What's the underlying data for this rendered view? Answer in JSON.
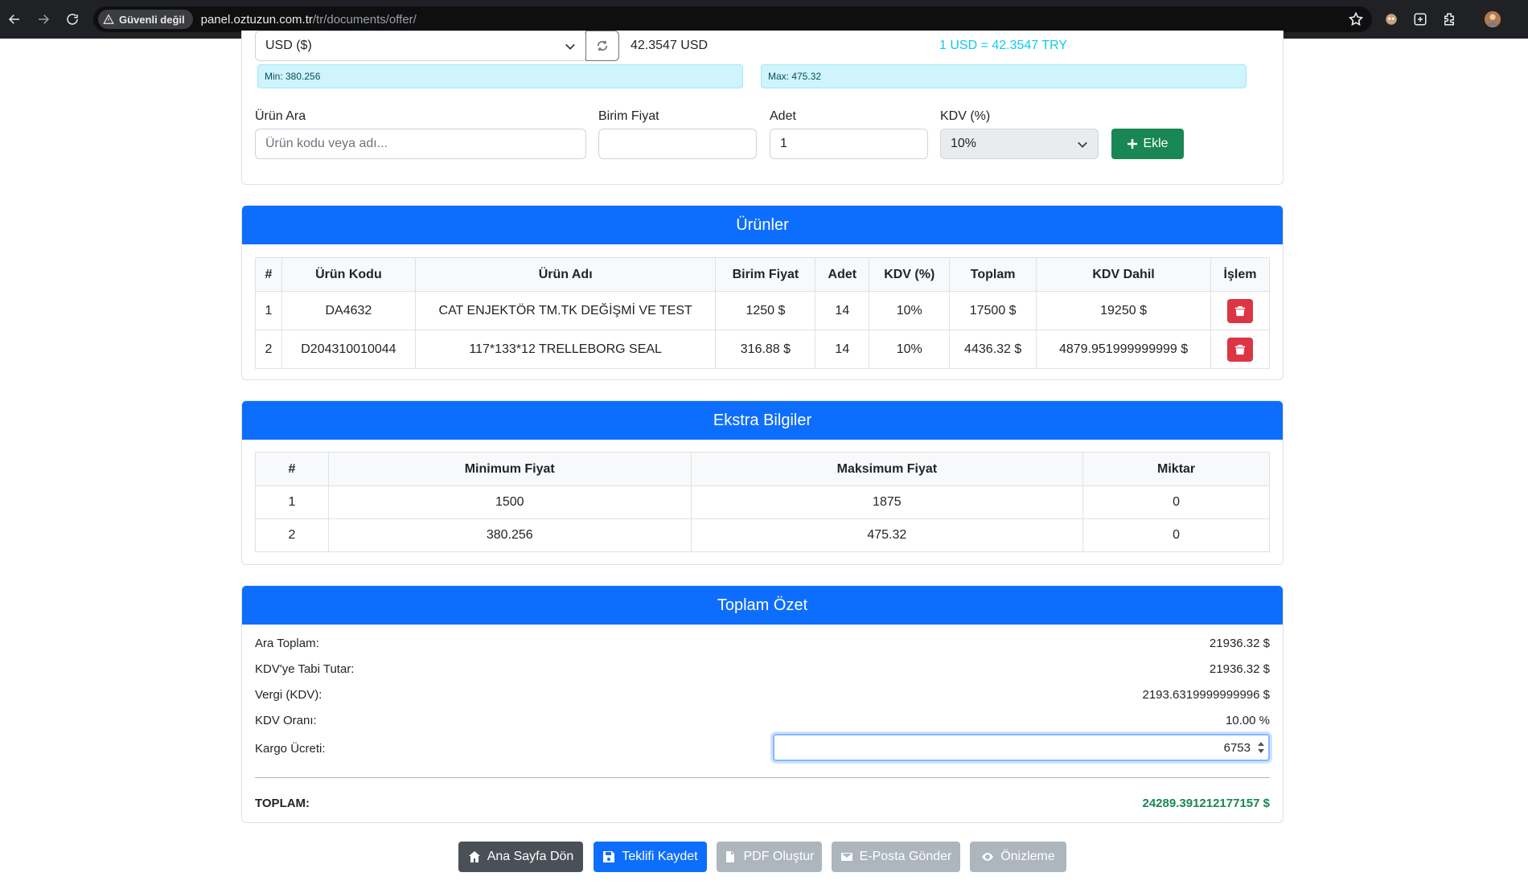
{
  "browser": {
    "security_label": "Güvenli değil",
    "url_host": "panel.oztuzun.com.tr",
    "url_path": "/tr/documents/offer/"
  },
  "currency": {
    "selected": "USD ($)",
    "rate_value": "42.3547 USD",
    "rate_info": "1 USD = 42.3547 TRY",
    "min_info": "Min: 380.256",
    "max_info": "Max: 475.32"
  },
  "product_form": {
    "search_label": "Ürün Ara",
    "search_placeholder": "Ürün kodu veya adı...",
    "unit_price_label": "Birim Fiyat",
    "unit_price_value": "",
    "qty_label": "Adet",
    "qty_value": "1",
    "vat_label": "KDV (%)",
    "vat_selected": "10%",
    "add_label": "Ekle"
  },
  "products": {
    "title": "Ürünler",
    "columns": [
      "#",
      "Ürün Kodu",
      "Ürün Adı",
      "Birim Fiyat",
      "Adet",
      "KDV (%)",
      "Toplam",
      "KDV Dahil",
      "İşlem"
    ],
    "rows": [
      {
        "no": "1",
        "code": "DA4632",
        "name": "CAT ENJEKTÖR TM.TK DEĞİŞMİ VE TEST",
        "unit_price": "1250 $",
        "qty": "14",
        "vat": "10%",
        "total": "17500 $",
        "total_vat": "19250 $"
      },
      {
        "no": "2",
        "code": "D204310010044",
        "name": "117*133*12 TRELLEBORG SEAL",
        "unit_price": "316.88 $",
        "qty": "14",
        "vat": "10%",
        "total": "4436.32 $",
        "total_vat": "4879.951999999999 $"
      }
    ]
  },
  "extra": {
    "title": "Ekstra Bilgiler",
    "columns": [
      "#",
      "Minimum Fiyat",
      "Maksimum Fiyat",
      "Miktar"
    ],
    "rows": [
      {
        "no": "1",
        "min": "1500",
        "max": "1875",
        "qty": "0"
      },
      {
        "no": "2",
        "min": "380.256",
        "max": "475.32",
        "qty": "0"
      }
    ]
  },
  "summary": {
    "title": "Toplam Özet",
    "subtotal_label": "Ara Toplam:",
    "subtotal_value": "21936.32 $",
    "taxable_label": "KDV'ye Tabi Tutar:",
    "taxable_value": "21936.32 $",
    "tax_label": "Vergi (KDV):",
    "tax_value": "2193.6319999999996 $",
    "rate_label": "KDV Oranı:",
    "rate_value": "10.00 %",
    "shipping_label": "Kargo Ücreti:",
    "shipping_value": "6753",
    "total_label": "TOPLAM:",
    "total_value": "24289.391212177157 $"
  },
  "actions": {
    "home": "Ana Sayfa Dön",
    "save": "Teklifi Kaydet",
    "pdf": "PDF Oluştur",
    "email": "E-Posta Gönder",
    "preview": "Önizleme"
  },
  "colors": {
    "primary": "#0d6efd",
    "danger": "#dc3545",
    "success": "#198754",
    "secondary": "#6c757d",
    "info_text": "#0dcaf0"
  }
}
